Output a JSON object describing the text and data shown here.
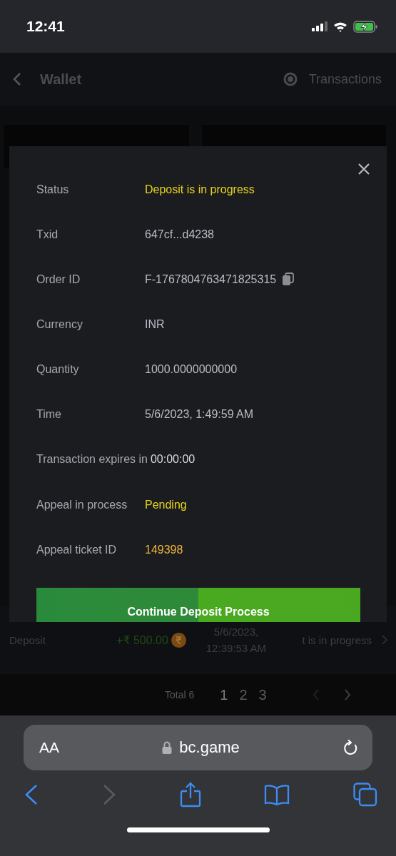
{
  "status_bar": {
    "time": "12:41"
  },
  "header": {
    "title": "Wallet",
    "transactions_label": "Transactions"
  },
  "modal": {
    "rows": [
      {
        "label": "Status",
        "value": "Deposit is in progress",
        "kind": "status"
      },
      {
        "label": "Txid",
        "value": "647cf...d4238",
        "kind": "plain"
      },
      {
        "label": "Order ID",
        "value": "F-1767804763471825315",
        "kind": "copy"
      },
      {
        "label": "Currency",
        "value": "INR",
        "kind": "plain"
      },
      {
        "label": "Quantity",
        "value": "1000.0000000000",
        "kind": "plain"
      },
      {
        "label": "Time",
        "value": "5/6/2023, 1:49:59 AM",
        "kind": "plain"
      },
      {
        "label": "Transaction expires in",
        "value": "00:00:00",
        "kind": "inline"
      },
      {
        "label": "Appeal in process",
        "value": "Pending",
        "kind": "status"
      },
      {
        "label": "Appeal ticket ID",
        "value": "149398",
        "kind": "ticket"
      }
    ],
    "button": "Continue Deposit Process"
  },
  "transaction_row": {
    "type": "Deposit",
    "amount": "+₹ 500.00",
    "date_line_1": "5/6/2023,",
    "date_line_2": "12:39:53 AM",
    "status": "t is in progress"
  },
  "pagination": {
    "total": "Total 6",
    "pages": [
      {
        "label": "1",
        "selected": true
      },
      {
        "label": "2",
        "selected": false
      },
      {
        "label": "3",
        "selected": false
      }
    ]
  },
  "browser": {
    "text_size": "AA",
    "url": "bc.game"
  }
}
